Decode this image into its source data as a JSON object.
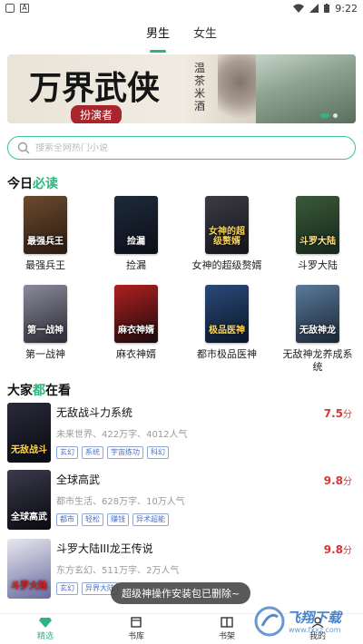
{
  "status": {
    "time": "9:22"
  },
  "tabs": [
    {
      "label": "男生",
      "active": true
    },
    {
      "label": "女生",
      "active": false
    }
  ],
  "banner": {
    "title": "万界武侠",
    "subtitle": "扮演者",
    "author": "温茶米酒"
  },
  "search": {
    "placeholder": "搜索全网热门小说"
  },
  "today": {
    "title_pre": "今日",
    "title_accent": "必读",
    "books": [
      {
        "name": "最强兵王",
        "cover_text": "最强兵王"
      },
      {
        "name": "捡漏",
        "cover_text": "捡漏"
      },
      {
        "name": "女神的超级赘婿",
        "cover_text": "女神的超级赘婿"
      },
      {
        "name": "斗罗大陆",
        "cover_text": "斗罗大陆"
      },
      {
        "name": "第一战神",
        "cover_text": "第一战神"
      },
      {
        "name": "麻衣神婿",
        "cover_text": "麻衣神婿"
      },
      {
        "name": "都市极品医神",
        "cover_text": "极品医神"
      },
      {
        "name": "无敌神龙养成系统",
        "cover_text": "无敌神龙"
      }
    ]
  },
  "popular": {
    "title_pre": "大家",
    "title_accent": "都",
    "title_post": "在看",
    "items": [
      {
        "title": "无敌战斗力系统",
        "score": "7.5",
        "unit": "分",
        "meta": "未来世界、422万字、4012人气",
        "tags": [
          "玄幻",
          "系统",
          "宇宙练功",
          "科幻"
        ],
        "cover_text": "无敌战斗"
      },
      {
        "title": "全球高武",
        "score": "9.8",
        "unit": "分",
        "meta": "都市生活、628万字、10万人气",
        "tags": [
          "都市",
          "轻松",
          "赚钱",
          "异术超能"
        ],
        "cover_text": "全球高武"
      },
      {
        "title": "斗罗大陆III龙王传说",
        "score": "9.8",
        "unit": "分",
        "meta": "东方玄幻、511万字、2万人气",
        "tags": [
          "玄幻",
          "异界大陆"
        ],
        "cover_text": "斗罗大陆"
      }
    ]
  },
  "toast": "超级神操作安装包已删除~",
  "nav": [
    {
      "label": "精选",
      "active": true,
      "icon": "diamond-icon"
    },
    {
      "label": "书库",
      "active": false,
      "icon": "library-icon"
    },
    {
      "label": "书架",
      "active": false,
      "icon": "bookshelf-icon"
    },
    {
      "label": "我的",
      "active": false,
      "icon": "user-icon"
    }
  ],
  "watermark": {
    "text": "飞翔下载",
    "sub": "www.fxxz.com"
  }
}
